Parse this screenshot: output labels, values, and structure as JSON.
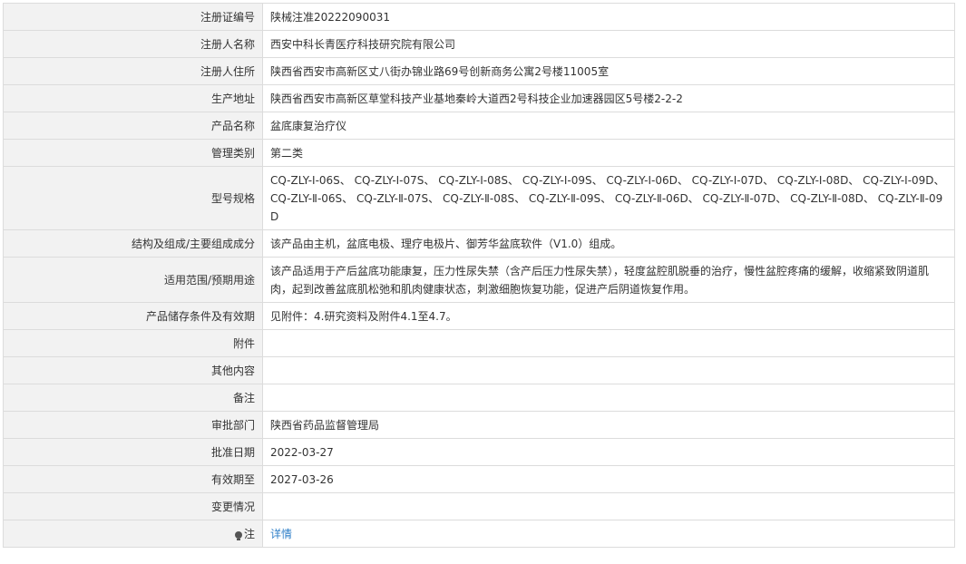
{
  "rows": [
    {
      "label": "注册证编号",
      "value": "陕械注准20222090031"
    },
    {
      "label": "注册人名称",
      "value": "西安中科长青医疗科技研究院有限公司"
    },
    {
      "label": "注册人住所",
      "value": "陕西省西安市高新区丈八街办锦业路69号创新商务公寓2号楼11005室"
    },
    {
      "label": "生产地址",
      "value": "陕西省西安市高新区草堂科技产业基地秦岭大道西2号科技企业加速器园区5号楼2-2-2"
    },
    {
      "label": "产品名称",
      "value": "盆底康复治疗仪"
    },
    {
      "label": "管理类别",
      "value": "第二类"
    },
    {
      "label": "型号规格",
      "value": "CQ-ZLY-Ⅰ-06S、 CQ-ZLY-Ⅰ-07S、 CQ-ZLY-Ⅰ-08S、 CQ-ZLY-Ⅰ-09S、 CQ-ZLY-Ⅰ-06D、 CQ-ZLY-Ⅰ-07D、 CQ-ZLY-Ⅰ-08D、 CQ-ZLY-Ⅰ-09D、 CQ-ZLY-Ⅱ-06S、 CQ-ZLY-Ⅱ-07S、 CQ-ZLY-Ⅱ-08S、 CQ-ZLY-Ⅱ-09S、 CQ-ZLY-Ⅱ-06D、 CQ-ZLY-Ⅱ-07D、 CQ-ZLY-Ⅱ-08D、 CQ-ZLY-Ⅱ-09D"
    },
    {
      "label": "结构及组成/主要组成成分",
      "value": "该产品由主机，盆底电极、理疗电极片、御芳华盆底软件（V1.0）组成。"
    },
    {
      "label": "适用范围/预期用途",
      "value": "该产品适用于产后盆底功能康复，压力性尿失禁（含产后压力性尿失禁），轻度盆腔肌脱垂的治疗，慢性盆腔疼痛的缓解，收缩紧致阴道肌肉，起到改善盆底肌松弛和肌肉健康状态，刺激细胞恢复功能，促进产后阴道恢复作用。"
    },
    {
      "label": "产品储存条件及有效期",
      "value": "见附件：4.研究资料及附件4.1至4.7。"
    },
    {
      "label": "附件",
      "value": ""
    },
    {
      "label": "其他内容",
      "value": ""
    },
    {
      "label": "备注",
      "value": ""
    },
    {
      "label": "审批部门",
      "value": "陕西省药品监督管理局"
    },
    {
      "label": "批准日期",
      "value": "2022-03-27"
    },
    {
      "label": "有效期至",
      "value": "2027-03-26"
    },
    {
      "label": "变更情况",
      "value": ""
    },
    {
      "label": "注",
      "value": "详情"
    }
  ],
  "icons": {
    "note": "lightbulb-icon"
  },
  "colors": {
    "label_bg": "#f2f2f2",
    "border": "#dcdcdc",
    "link": "#2f7fc8"
  }
}
